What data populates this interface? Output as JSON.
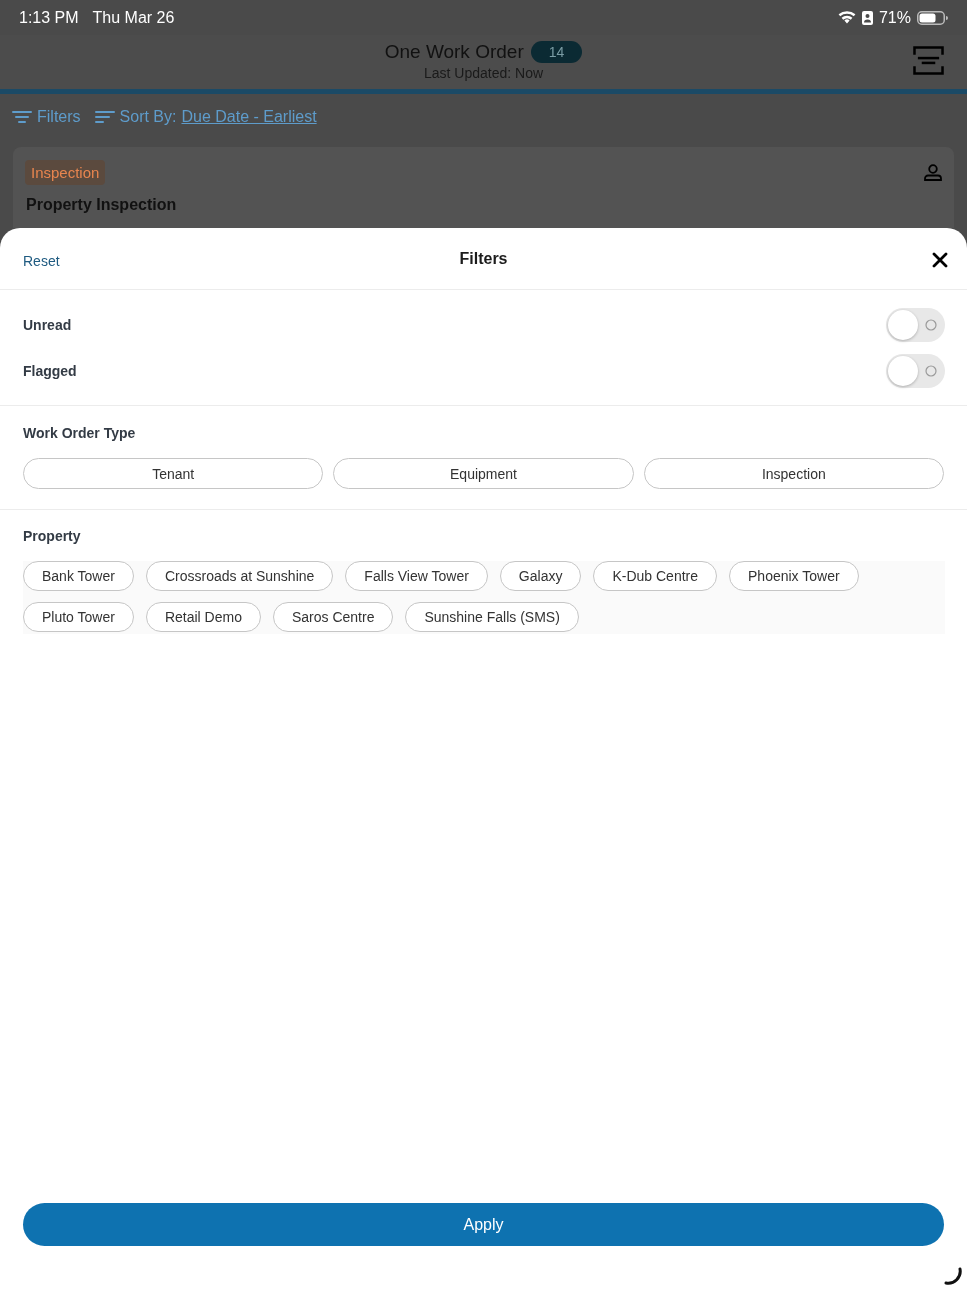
{
  "status_bar": {
    "time": "1:13 PM",
    "date": "Thu Mar 26",
    "battery": "71%"
  },
  "app_header": {
    "title": "One Work Order",
    "count": "14",
    "subtitle": "Last Updated: Now"
  },
  "toolbar": {
    "filters": "Filters",
    "sort_label": "Sort By:",
    "sort_value": "Due Date - Earliest"
  },
  "card": {
    "tag": "Inspection",
    "title": "Property Inspection"
  },
  "filter_sheet": {
    "reset": "Reset",
    "title": "Filters",
    "toggles": [
      {
        "label": "Unread",
        "on": false
      },
      {
        "label": "Flagged",
        "on": false
      }
    ],
    "work_order_type": {
      "heading": "Work Order Type",
      "options": [
        {
          "label": "Tenant",
          "selected": false
        },
        {
          "label": "Equipment",
          "selected": false
        },
        {
          "label": "Inspection",
          "selected": false
        }
      ]
    },
    "property": {
      "heading": "Property",
      "options": [
        {
          "label": "Bank Tower",
          "selected": false
        },
        {
          "label": "Crossroads at Sunshine",
          "selected": false
        },
        {
          "label": "Falls View Tower",
          "selected": false
        },
        {
          "label": "Galaxy",
          "selected": false
        },
        {
          "label": "K-Dub Centre",
          "selected": false
        },
        {
          "label": "Phoenix Tower",
          "selected": false
        },
        {
          "label": "Pluto Tower",
          "selected": false
        },
        {
          "label": "Retail Demo",
          "selected": false
        },
        {
          "label": "Saros Centre",
          "selected": false
        },
        {
          "label": "Sunshine Falls (SMS)",
          "selected": false
        }
      ]
    },
    "apply": "Apply"
  }
}
